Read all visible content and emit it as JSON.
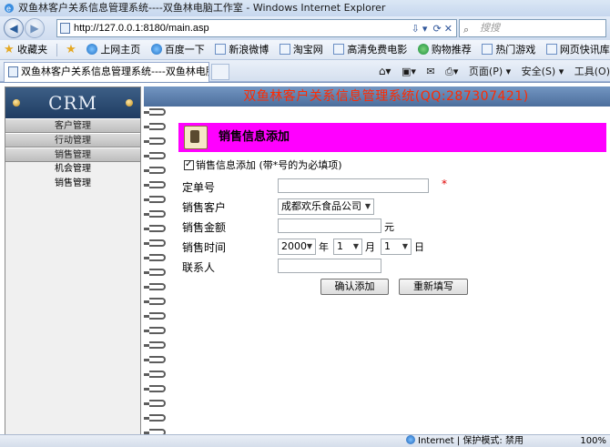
{
  "window": {
    "title": "双鱼林客户关系信息管理系统----双鱼林电脑工作室 - Windows Internet Explorer"
  },
  "address_bar": {
    "url": "http://127.0.0.1:8180/main.asp",
    "search_placeholder": "搜搜"
  },
  "favorites_bar": {
    "favorites_label": "收藏夹",
    "items": [
      {
        "label": "上网主页",
        "icon": "ie-icon"
      },
      {
        "label": "百度一下",
        "icon": "ie-icon"
      },
      {
        "label": "新浪微博",
        "icon": "page-icon"
      },
      {
        "label": "淘宝网",
        "icon": "page-icon"
      },
      {
        "label": "高清免费电影",
        "icon": "page-icon"
      },
      {
        "label": "购物推荐",
        "icon": "globe-icon"
      },
      {
        "label": "热门游戏",
        "icon": "page-icon"
      },
      {
        "label": "网页快讯库 ▾",
        "icon": "page-icon"
      }
    ]
  },
  "tab_bar": {
    "active_tab": "双鱼林客户关系信息管理系统----双鱼林电脑工作...",
    "commands": {
      "page": "页面(P) ▾",
      "safety": "安全(S) ▾",
      "tools": "工具(O)"
    }
  },
  "sidebar": {
    "logo": "CRM",
    "menu": [
      {
        "label": "客户管理",
        "type": "header"
      },
      {
        "label": "行动管理",
        "type": "header"
      },
      {
        "label": "销售管理",
        "type": "header"
      },
      {
        "label": "机会管理",
        "type": "sub"
      },
      {
        "label": "销售管理",
        "type": "sub"
      }
    ]
  },
  "header": {
    "system_title": "双鱼林客户关系信息管理系统(QQ:287307421)"
  },
  "form": {
    "title": "销售信息添加",
    "subtitle": "销售信息添加 (带*号的为必填项)",
    "fields": {
      "order_no": {
        "label": "定单号",
        "value": "",
        "required_mark": "*"
      },
      "customer": {
        "label": "销售客户",
        "value": "成都欢乐食品公司"
      },
      "amount": {
        "label": "销售金额",
        "value": "",
        "unit": "元"
      },
      "date": {
        "label": "销售时间",
        "year": "2000",
        "year_unit": "年",
        "month": "1",
        "month_unit": "月",
        "day": "1",
        "day_unit": "日"
      },
      "contact": {
        "label": "联系人",
        "value": ""
      }
    },
    "buttons": {
      "submit": "确认添加",
      "reset": "重新填写"
    }
  },
  "status_bar": {
    "zone": "Internet | 保护模式: 禁用",
    "zoom": "100%"
  }
}
